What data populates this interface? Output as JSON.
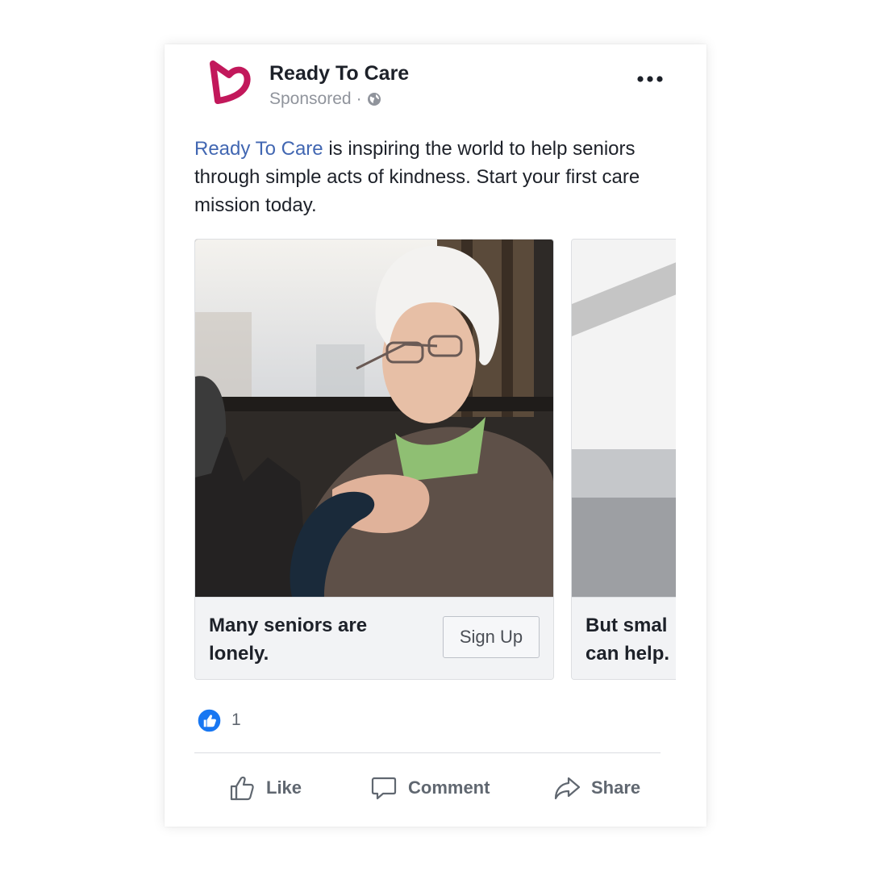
{
  "post": {
    "page_name": "Ready To Care",
    "sponsored_label": "Sponsored",
    "separator": "·",
    "body_link": "Ready To Care",
    "body_text": " is inspiring the world to help seniors through simple acts of kindness. Start your first care mission today."
  },
  "carousel": {
    "cards": [
      {
        "headline": "Many seniors are lonely.",
        "cta_label": "Sign Up"
      },
      {
        "headline_line1": "But smal",
        "headline_line2": "can help."
      }
    ]
  },
  "reactions": {
    "count": "1"
  },
  "actions": {
    "like": "Like",
    "comment": "Comment",
    "share": "Share"
  },
  "colors": {
    "brand_link": "#4267b2",
    "logo_magenta": "#c2185b",
    "like_badge_blue": "#1877f2",
    "text_primary": "#1d2129",
    "text_secondary": "#606770"
  },
  "icons": {
    "logo": "heart-logo-icon",
    "privacy": "globe-icon",
    "more": "more-dots-icon",
    "reaction": "like-reaction-icon",
    "like": "thumbs-up-icon",
    "comment": "comment-bubble-icon",
    "share": "share-arrow-icon"
  }
}
